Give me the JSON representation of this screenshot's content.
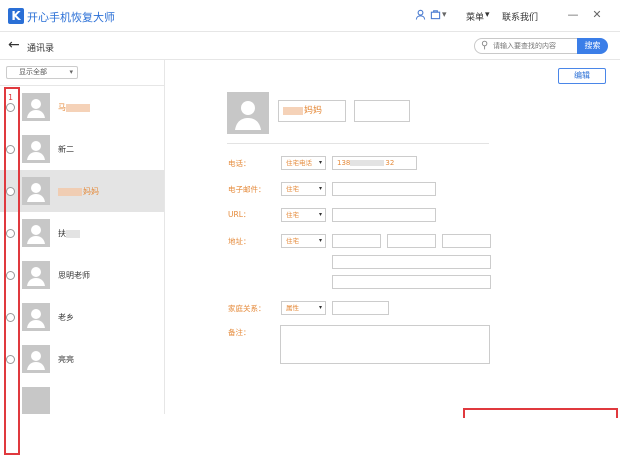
{
  "app": {
    "logo_letter": "K",
    "title": "开心手机恢复大师"
  },
  "titlebar": {
    "user_icon": "user-icon",
    "shop_icon": "cart-icon",
    "dropdown_caret": "▾",
    "menu_label": "菜单",
    "menu_caret": "▾",
    "contact_label": "联系我们",
    "minimize": "—",
    "close": "✕"
  },
  "nav": {
    "back_icon": "←",
    "title": "通讯录"
  },
  "search": {
    "placeholder": "请输入要查找的内容",
    "button": "搜索"
  },
  "filter": {
    "label": "显示全部",
    "caret": "▾"
  },
  "annotations": {
    "left_number": "1"
  },
  "contacts": [
    {
      "name": "马",
      "highlighted": false
    },
    {
      "name": "新二",
      "highlighted": false
    },
    {
      "name": "妈妈",
      "highlighted": true
    },
    {
      "name": "扶",
      "highlighted": false
    },
    {
      "name": "思明老师",
      "highlighted": false
    },
    {
      "name": "老乡",
      "highlighted": false
    },
    {
      "name": "亮亮",
      "highlighted": false
    }
  ],
  "detail": {
    "edit_button": "编辑",
    "name": "妈妈",
    "phone_label": "电话：",
    "phone_type": "住宅电话",
    "phone_value": "138",
    "phone_tail": "32",
    "email_label": "电子邮件：",
    "email_type": "住宅",
    "url_label": "URL：",
    "url_type": "住宅",
    "address_label": "地址：",
    "address_type": "住宅",
    "family_label": "家庭关系：",
    "family_type": "属性",
    "notes_label": "备注：",
    "caret": "▾"
  },
  "colors": {
    "accent": "#2a6fd6",
    "label_orange": "#e58a3a",
    "annotation_red": "#e0393e",
    "selected_row": "#e4e4e4"
  }
}
